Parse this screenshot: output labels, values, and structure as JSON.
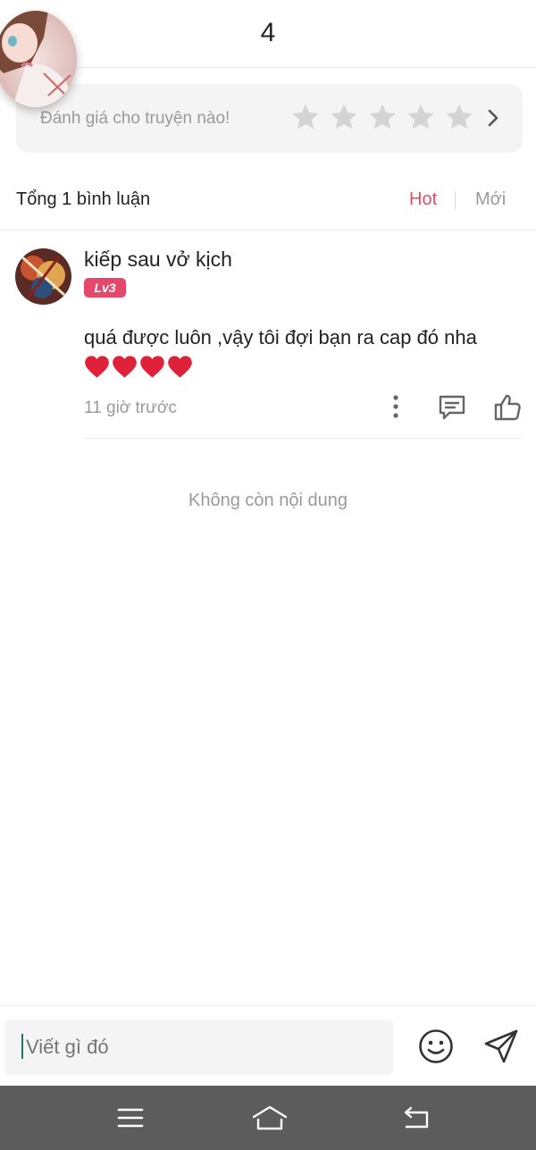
{
  "header": {
    "title": "4"
  },
  "rating": {
    "prompt": "Đánh giá cho truyện nào!",
    "stars_filled": 0,
    "stars_total": 5
  },
  "comments_header": {
    "count_label": "Tổng 1 bình luận",
    "sort_hot": "Hot",
    "sort_new": "Mới",
    "active_sort": "Hot"
  },
  "comments": [
    {
      "username": "kiếp sau vở kịch",
      "level": "Lv3",
      "text": "quá được luôn ,vậy tôi đợi bạn ra cap đó nha",
      "hearts": 4,
      "time": "11 giờ trước"
    }
  ],
  "end_message": "Không còn nội dung",
  "composer": {
    "placeholder": "Viết gì đó"
  },
  "colors": {
    "accent": "#d9506a",
    "level_badge": "#e5486b",
    "nav_bar": "#5c5c5c"
  },
  "icons": [
    "star-icon",
    "chevron-right-icon",
    "more-vertical-icon",
    "reply-icon",
    "thumbs-up-icon",
    "emoji-icon",
    "send-icon",
    "menu-icon",
    "home-icon",
    "back-icon",
    "heart-icon"
  ]
}
